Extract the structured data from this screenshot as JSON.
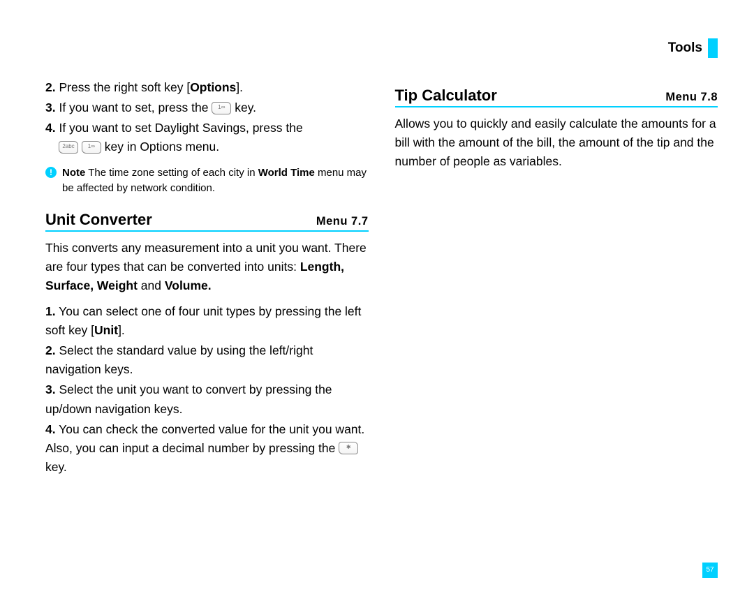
{
  "header": {
    "title": "Tools"
  },
  "worldtime": {
    "steps": {
      "s2": {
        "num": "2.",
        "text_pre": " Press the right soft key [",
        "bold": "Options",
        "text_post": "]."
      },
      "s3": {
        "num": "3.",
        "text_pre": " If you want to set, press the ",
        "text_post": " key."
      },
      "s4": {
        "num": "4.",
        "text_pre": " If you want to set Daylight Savings, press the",
        "line2_post": " key in Options menu."
      }
    },
    "note": {
      "label": "Note",
      "text_pre": "  The time zone setting of each city in ",
      "bold": "World Time",
      "text_post": " menu may be affected by network condition."
    }
  },
  "unitConverter": {
    "title": "Unit Converter",
    "menu": "Menu 7.7",
    "intro_pre": "This converts any measurement into a unit you want. There are four types that can be converted into units: ",
    "intro_bold_1": "Length, Surface, Weight",
    "intro_mid": " and ",
    "intro_bold_2": "Volume.",
    "steps": {
      "s1": {
        "num": "1.",
        "text_pre": " You can select one of four unit types by pressing the left soft key [",
        "bold": "Unit",
        "text_post": "]."
      },
      "s2": {
        "num": "2.",
        "text": " Select the standard value by using the left/right navigation keys."
      },
      "s3": {
        "num": "3.",
        "text": " Select the unit you want to convert by pressing the up/down navigation keys."
      },
      "s4": {
        "num": "4.",
        "text_pre": " You can check the converted value for the unit you want. Also, you can input a decimal number by pressing the ",
        "text_post": " key."
      }
    }
  },
  "tipCalculator": {
    "title": "Tip Calculator",
    "menu": "Menu 7.8",
    "intro": "Allows you to quickly and easily calculate the amounts for a bill with the amount of the bill, the amount of the tip and the number of people as variables."
  },
  "pageNumber": "57",
  "keys": {
    "one": "1∞",
    "two": "2abc",
    "star": "✱"
  }
}
